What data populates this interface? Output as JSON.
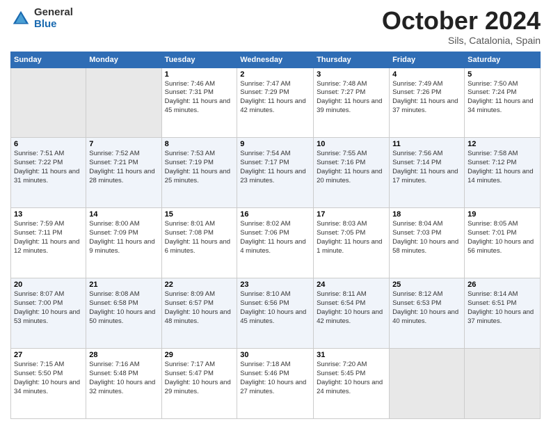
{
  "header": {
    "logo_general": "General",
    "logo_blue": "Blue",
    "month": "October 2024",
    "location": "Sils, Catalonia, Spain"
  },
  "days_of_week": [
    "Sunday",
    "Monday",
    "Tuesday",
    "Wednesday",
    "Thursday",
    "Friday",
    "Saturday"
  ],
  "weeks": [
    [
      {
        "day": "",
        "info": ""
      },
      {
        "day": "",
        "info": ""
      },
      {
        "day": "1",
        "info": "Sunrise: 7:46 AM\nSunset: 7:31 PM\nDaylight: 11 hours and 45 minutes."
      },
      {
        "day": "2",
        "info": "Sunrise: 7:47 AM\nSunset: 7:29 PM\nDaylight: 11 hours and 42 minutes."
      },
      {
        "day": "3",
        "info": "Sunrise: 7:48 AM\nSunset: 7:27 PM\nDaylight: 11 hours and 39 minutes."
      },
      {
        "day": "4",
        "info": "Sunrise: 7:49 AM\nSunset: 7:26 PM\nDaylight: 11 hours and 37 minutes."
      },
      {
        "day": "5",
        "info": "Sunrise: 7:50 AM\nSunset: 7:24 PM\nDaylight: 11 hours and 34 minutes."
      }
    ],
    [
      {
        "day": "6",
        "info": "Sunrise: 7:51 AM\nSunset: 7:22 PM\nDaylight: 11 hours and 31 minutes."
      },
      {
        "day": "7",
        "info": "Sunrise: 7:52 AM\nSunset: 7:21 PM\nDaylight: 11 hours and 28 minutes."
      },
      {
        "day": "8",
        "info": "Sunrise: 7:53 AM\nSunset: 7:19 PM\nDaylight: 11 hours and 25 minutes."
      },
      {
        "day": "9",
        "info": "Sunrise: 7:54 AM\nSunset: 7:17 PM\nDaylight: 11 hours and 23 minutes."
      },
      {
        "day": "10",
        "info": "Sunrise: 7:55 AM\nSunset: 7:16 PM\nDaylight: 11 hours and 20 minutes."
      },
      {
        "day": "11",
        "info": "Sunrise: 7:56 AM\nSunset: 7:14 PM\nDaylight: 11 hours and 17 minutes."
      },
      {
        "day": "12",
        "info": "Sunrise: 7:58 AM\nSunset: 7:12 PM\nDaylight: 11 hours and 14 minutes."
      }
    ],
    [
      {
        "day": "13",
        "info": "Sunrise: 7:59 AM\nSunset: 7:11 PM\nDaylight: 11 hours and 12 minutes."
      },
      {
        "day": "14",
        "info": "Sunrise: 8:00 AM\nSunset: 7:09 PM\nDaylight: 11 hours and 9 minutes."
      },
      {
        "day": "15",
        "info": "Sunrise: 8:01 AM\nSunset: 7:08 PM\nDaylight: 11 hours and 6 minutes."
      },
      {
        "day": "16",
        "info": "Sunrise: 8:02 AM\nSunset: 7:06 PM\nDaylight: 11 hours and 4 minutes."
      },
      {
        "day": "17",
        "info": "Sunrise: 8:03 AM\nSunset: 7:05 PM\nDaylight: 11 hours and 1 minute."
      },
      {
        "day": "18",
        "info": "Sunrise: 8:04 AM\nSunset: 7:03 PM\nDaylight: 10 hours and 58 minutes."
      },
      {
        "day": "19",
        "info": "Sunrise: 8:05 AM\nSunset: 7:01 PM\nDaylight: 10 hours and 56 minutes."
      }
    ],
    [
      {
        "day": "20",
        "info": "Sunrise: 8:07 AM\nSunset: 7:00 PM\nDaylight: 10 hours and 53 minutes."
      },
      {
        "day": "21",
        "info": "Sunrise: 8:08 AM\nSunset: 6:58 PM\nDaylight: 10 hours and 50 minutes."
      },
      {
        "day": "22",
        "info": "Sunrise: 8:09 AM\nSunset: 6:57 PM\nDaylight: 10 hours and 48 minutes."
      },
      {
        "day": "23",
        "info": "Sunrise: 8:10 AM\nSunset: 6:56 PM\nDaylight: 10 hours and 45 minutes."
      },
      {
        "day": "24",
        "info": "Sunrise: 8:11 AM\nSunset: 6:54 PM\nDaylight: 10 hours and 42 minutes."
      },
      {
        "day": "25",
        "info": "Sunrise: 8:12 AM\nSunset: 6:53 PM\nDaylight: 10 hours and 40 minutes."
      },
      {
        "day": "26",
        "info": "Sunrise: 8:14 AM\nSunset: 6:51 PM\nDaylight: 10 hours and 37 minutes."
      }
    ],
    [
      {
        "day": "27",
        "info": "Sunrise: 7:15 AM\nSunset: 5:50 PM\nDaylight: 10 hours and 34 minutes."
      },
      {
        "day": "28",
        "info": "Sunrise: 7:16 AM\nSunset: 5:48 PM\nDaylight: 10 hours and 32 minutes."
      },
      {
        "day": "29",
        "info": "Sunrise: 7:17 AM\nSunset: 5:47 PM\nDaylight: 10 hours and 29 minutes."
      },
      {
        "day": "30",
        "info": "Sunrise: 7:18 AM\nSunset: 5:46 PM\nDaylight: 10 hours and 27 minutes."
      },
      {
        "day": "31",
        "info": "Sunrise: 7:20 AM\nSunset: 5:45 PM\nDaylight: 10 hours and 24 minutes."
      },
      {
        "day": "",
        "info": ""
      },
      {
        "day": "",
        "info": ""
      }
    ]
  ]
}
